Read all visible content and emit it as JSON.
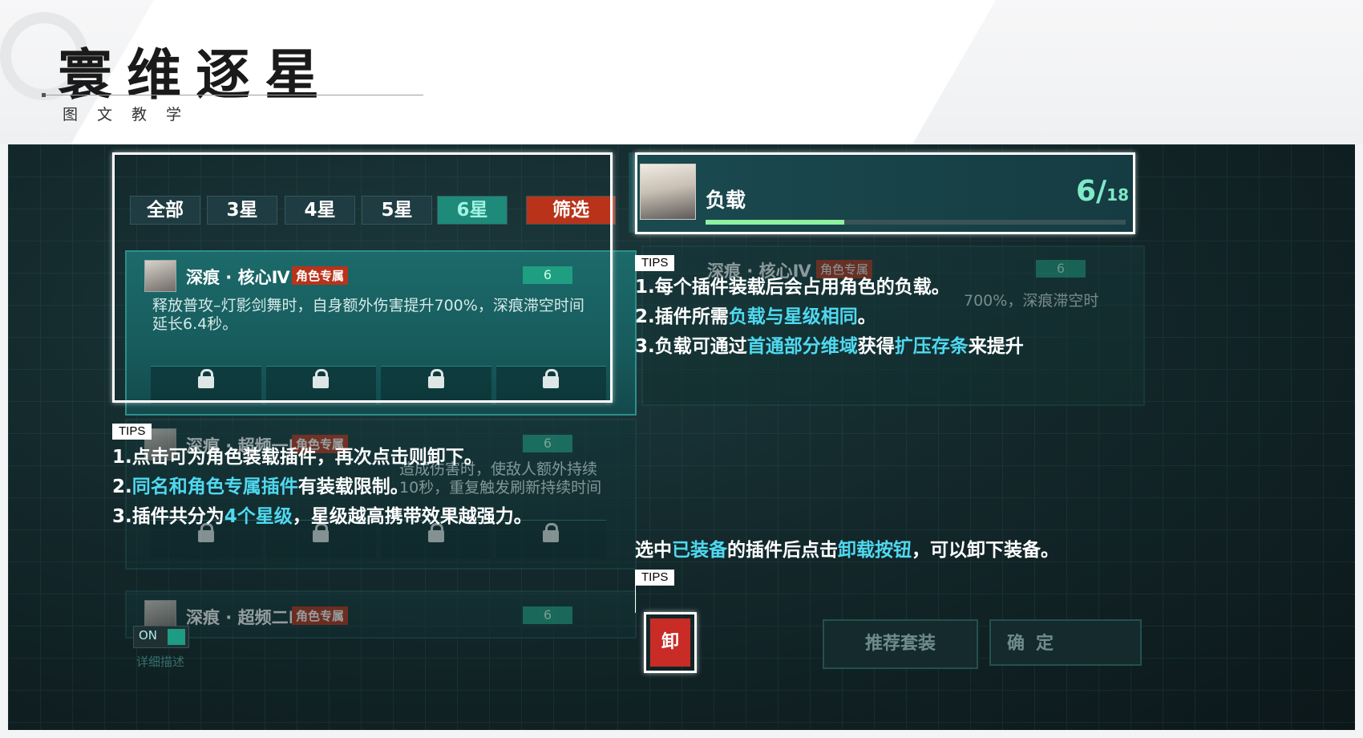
{
  "header": {
    "title": "寰维逐星",
    "subtitle": "图文教学"
  },
  "filter_tabs": [
    {
      "label": "全部",
      "active": false
    },
    {
      "label": "3星",
      "active": false
    },
    {
      "label": "4星",
      "active": false
    },
    {
      "label": "5星",
      "active": false
    },
    {
      "label": "6星",
      "active": true
    }
  ],
  "filter_button": "筛选",
  "plugins": [
    {
      "name": "深痕 · 核心Ⅳ",
      "badge": "角色专属",
      "level": "6",
      "desc": "释放普攻–灯影剑舞时，自身额外伤害提升700%，深痕滞空时间延长6.4秒。"
    },
    {
      "name": "深痕 · 超频一Ⅳ",
      "badge": "角色专属",
      "level": "6",
      "desc": "造成伤害时，使敌人额外持续10秒，重复触发刷新持续时间"
    },
    {
      "name": "深痕 · 超频二Ⅳ",
      "badge": "角色专属",
      "level": "6"
    }
  ],
  "load": {
    "label": "负载",
    "current": "6/",
    "total": "18",
    "fill_fraction": 0.33
  },
  "ghost": {
    "name": "深痕 · 核心Ⅳ",
    "badge": "角色专属",
    "level": "6",
    "desc": "700%，深痕滞空时"
  },
  "tips_label": "TIPS",
  "tips_left": {
    "line1": "1.点击可为角色装载插件，再次点击则卸下。",
    "line2_prefix": "2.",
    "line2_hl": "同名和角色专属插件",
    "line2_suffix": "有装载限制。",
    "line3_prefix": "3.插件共分为",
    "line3_hl": "4个星级",
    "line3_suffix": "，星级越高携带效果越强力。"
  },
  "tips_right": {
    "line1": "1.每个插件装载后会占用角色的负载。",
    "line2_prefix": "2.插件所需",
    "line2_hl": "负载与星级相同",
    "line2_suffix": "。",
    "line3_prefix": "3.负载可通过",
    "line3_hl1": "首通部分维域",
    "line3_mid": "获得",
    "line3_hl2": "扩压存条",
    "line3_suffix": "来提升"
  },
  "unload_tip": {
    "prefix": "选中",
    "hl1": "已装备",
    "mid": "的插件后点击",
    "hl2": "卸载按钮",
    "suffix": "，可以卸下装备。"
  },
  "unload_button": "卸",
  "toggle_label": "ON",
  "detail_label": "详细描述",
  "recommend_button": "推荐套装",
  "confirm_button": "确定",
  "colors": {
    "accent_cyan": "#4fd9f0",
    "active_tab": "#1d8a7a",
    "filter_red": "#b8331a",
    "unload_red": "#c92b26",
    "load_green": "#8ff0a0"
  }
}
